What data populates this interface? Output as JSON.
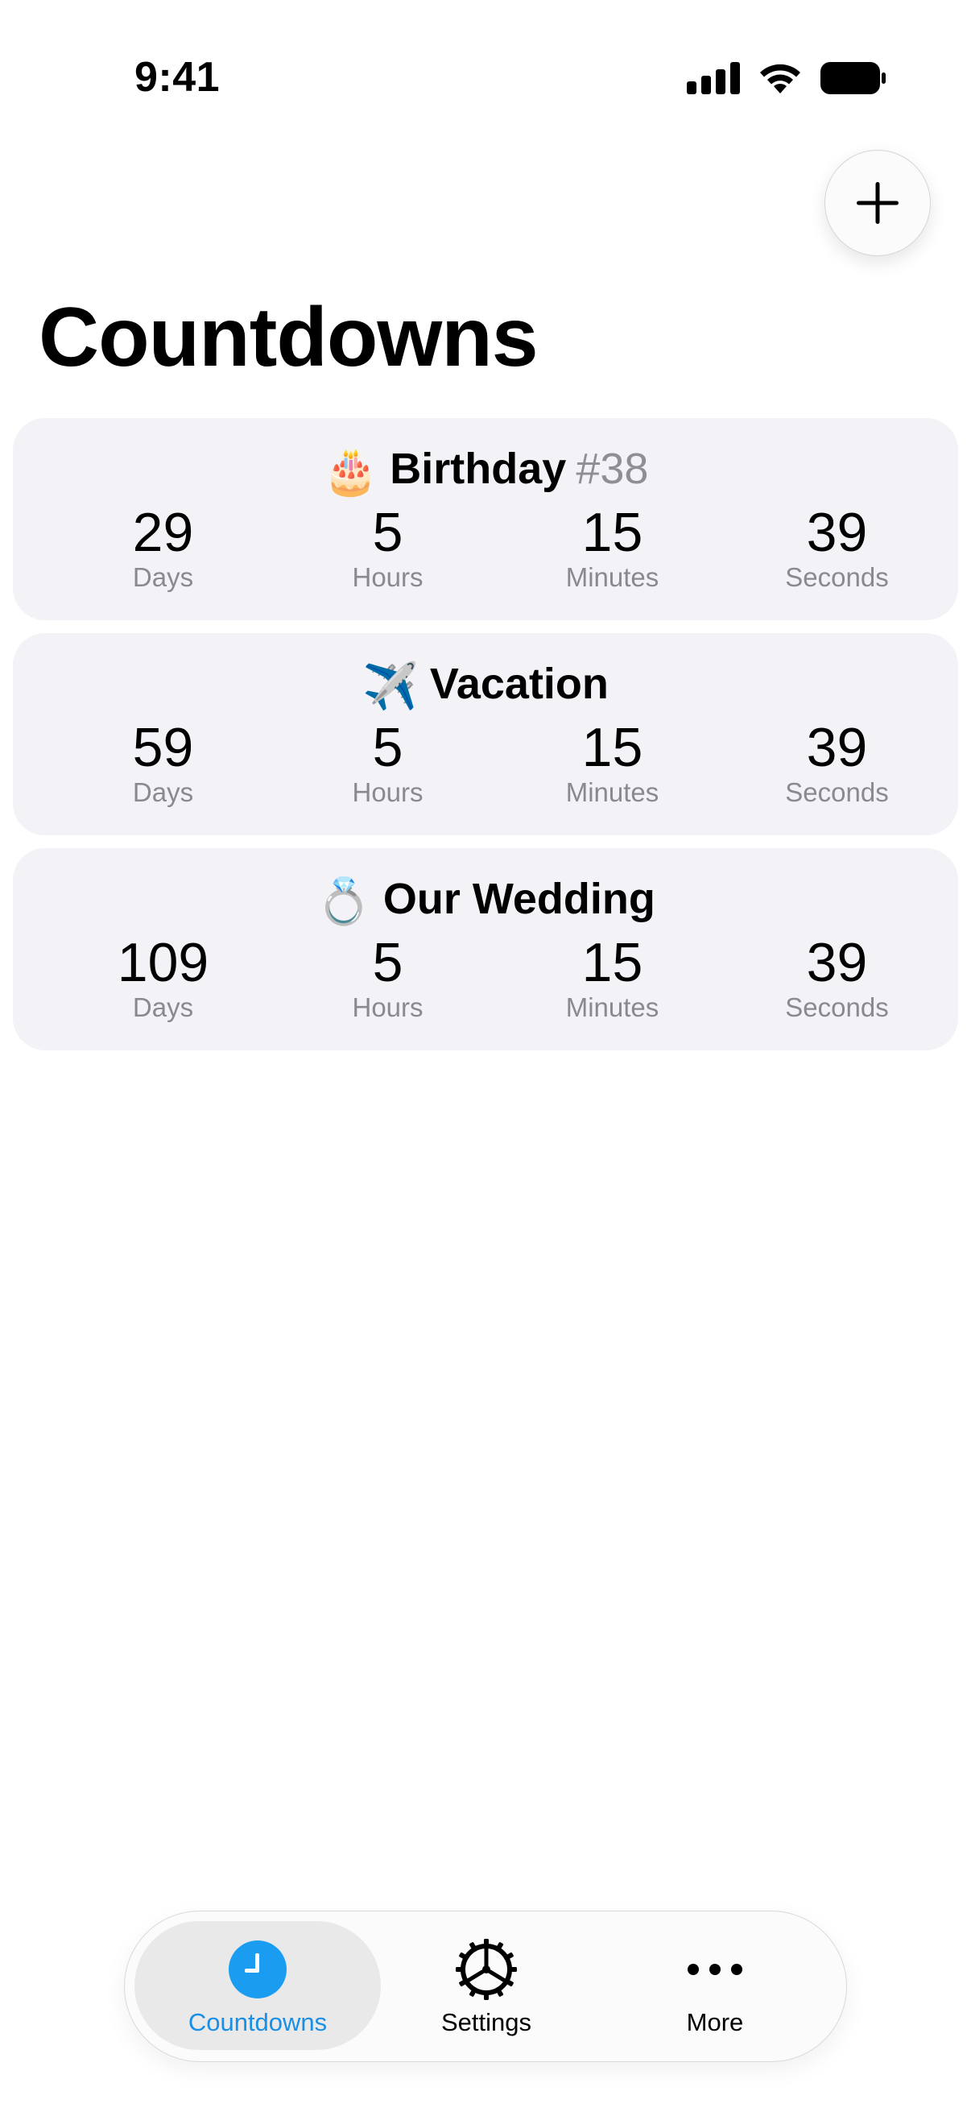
{
  "status_bar": {
    "time": "9:41",
    "icons": [
      "cellular-signal-icon",
      "wifi-icon",
      "battery-icon"
    ]
  },
  "header": {
    "add_icon": "plus-icon",
    "title": "Countdowns"
  },
  "countdowns": [
    {
      "emoji": "🎂",
      "name": "Birthday",
      "tag": "#38",
      "days": "29",
      "hours": "5",
      "minutes": "15",
      "seconds": "39"
    },
    {
      "emoji": "✈️",
      "name": "Vacation",
      "tag": "",
      "days": "59",
      "hours": "5",
      "minutes": "15",
      "seconds": "39"
    },
    {
      "emoji": "💍",
      "name": "Our Wedding",
      "tag": "",
      "days": "109",
      "hours": "5",
      "minutes": "15",
      "seconds": "39"
    }
  ],
  "unit_labels": {
    "days": "Days",
    "hours": "Hours",
    "minutes": "Minutes",
    "seconds": "Seconds"
  },
  "tab_bar": {
    "tabs": [
      {
        "label": "Countdowns",
        "icon": "clock-icon",
        "selected": true
      },
      {
        "label": "Settings",
        "icon": "gear-icon",
        "selected": false
      },
      {
        "label": "More",
        "icon": "ellipsis-icon",
        "selected": false
      }
    ]
  },
  "colors": {
    "accent": "#1a8fe3",
    "card_background": "#f2f2f7",
    "secondary_text": "#8a8a8e"
  }
}
